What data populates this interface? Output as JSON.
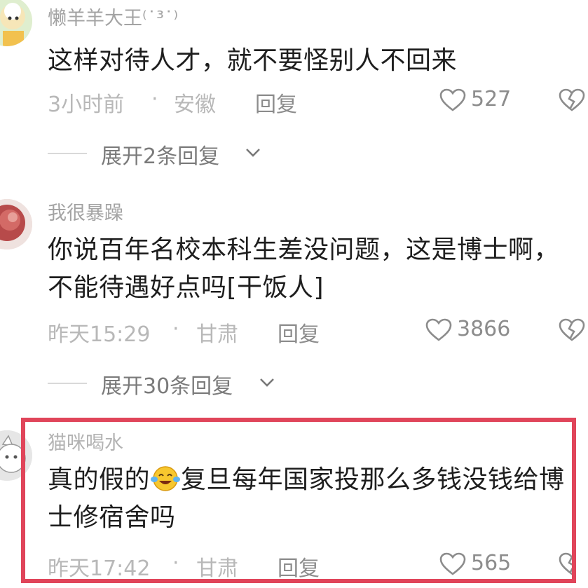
{
  "comments": [
    {
      "username": "懒羊羊大王⁽˙³˙⁾",
      "text": "这样对待人才，就不要怪别人不回来",
      "time": "3小时前",
      "dot": "·",
      "location": "安徽",
      "reply_label": "回复",
      "likes": "527",
      "expand_label": "展开2条回复"
    },
    {
      "username": "我很暴躁",
      "text": "你说百年名校本科生差没问题，这是博士啊，不能待遇好点吗[干饭人]",
      "time": "昨天15:29",
      "dot": "·",
      "location": "甘肃",
      "reply_label": "回复",
      "likes": "3866",
      "expand_label": "展开30条回复"
    },
    {
      "username": "猫咪喝水",
      "text_before": "真的假的",
      "emoji": "laughing-crying-emoji",
      "text_after": "复旦每年国家投那么多钱没钱给博士修宿舍吗",
      "time": "昨天17:42",
      "dot": "·",
      "location": "甘肃",
      "reply_label": "回复",
      "likes": "565"
    }
  ],
  "colors": {
    "highlight_border": "#e0455a",
    "username": "#a3a3a3",
    "body_text": "#1e1e1e",
    "meta_text": "#b8b8b8"
  }
}
